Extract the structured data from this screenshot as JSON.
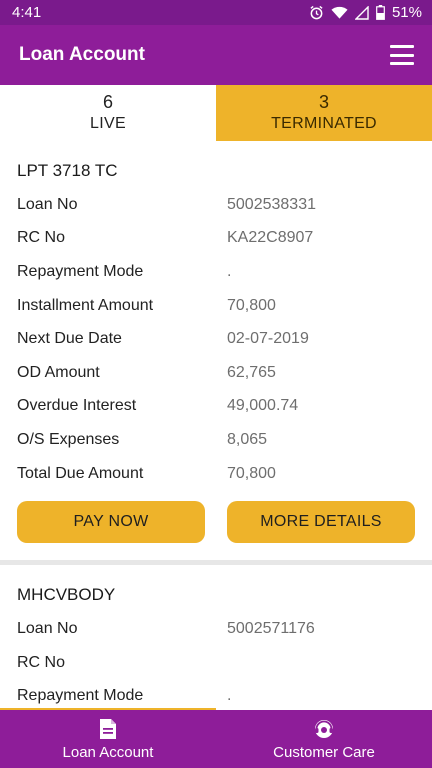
{
  "status_bar": {
    "time": "4:41",
    "battery": "51%",
    "icons": [
      "alarm-icon",
      "wifi-icon",
      "signal-icon",
      "battery-icon"
    ]
  },
  "app_bar": {
    "title": "Loan Account",
    "menu_icon": "hamburger-menu-icon"
  },
  "tabs": [
    {
      "count": "6",
      "label": "LIVE",
      "selected": true
    },
    {
      "count": "3",
      "label": "TERMINATED",
      "selected": false
    }
  ],
  "loans": [
    {
      "title": "LPT 3718 TC",
      "rows": [
        {
          "label": "Loan No",
          "value": "5002538331"
        },
        {
          "label": "RC No",
          "value": "KA22C8907"
        },
        {
          "label": "Repayment Mode",
          "value": "."
        },
        {
          "label": "Installment Amount",
          "value": "70,800"
        },
        {
          "label": "Next Due Date",
          "value": "02-07-2019"
        },
        {
          "label": "OD Amount",
          "value": "62,765"
        },
        {
          "label": "Overdue Interest",
          "value": "49,000.74"
        },
        {
          "label": "O/S Expenses",
          "value": "8,065"
        },
        {
          "label": "Total Due Amount",
          "value": "70,800"
        }
      ],
      "pay_label": "PAY NOW",
      "details_label": "MORE DETAILS"
    },
    {
      "title": "MHCVBODY",
      "rows": [
        {
          "label": "Loan No",
          "value": "5002571176"
        },
        {
          "label": "RC No",
          "value": ""
        },
        {
          "label": "Repayment Mode",
          "value": "."
        }
      ]
    }
  ],
  "bottom_nav": [
    {
      "label": "Loan Account",
      "icon": "document-icon"
    },
    {
      "label": "Customer Care",
      "icon": "customer-care-icon"
    }
  ],
  "colors": {
    "primary": "#8e1d99",
    "status_bar": "#7a1a8c",
    "accent": "#eeb32a"
  }
}
